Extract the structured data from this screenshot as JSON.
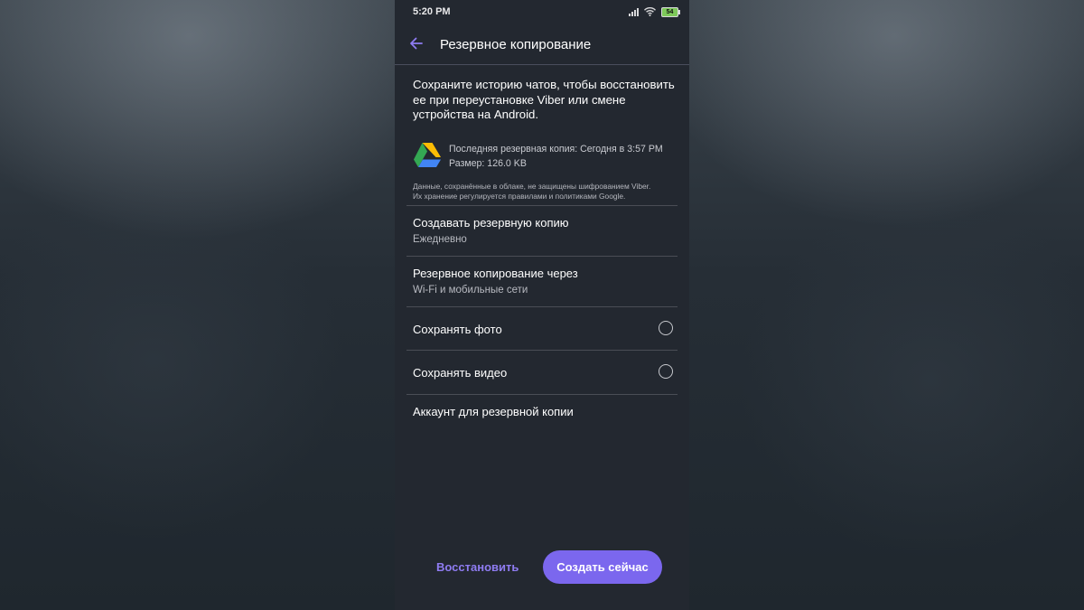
{
  "status_bar": {
    "time": "5:20 PM",
    "battery": "54"
  },
  "app_bar": {
    "title": "Резервное копирование"
  },
  "intro_text": "Сохраните историю чатов, чтобы восстановить ее при переустановке Viber или смене устройства на Android.",
  "backup_info": {
    "last_backup": "Последняя резервная копия: Сегодня в 3:57 PM",
    "size": "Размер: 126.0 KB"
  },
  "notice": {
    "line1": "Данные, сохранённые в облаке, не защищены шифрованием Viber.",
    "line2": "Их хранение регулируется правилами и политиками Google."
  },
  "settings": {
    "create_backup": {
      "title": "Создавать резервную копию",
      "value": "Ежедневно"
    },
    "backup_via": {
      "title": "Резервное копирование через",
      "value": "Wi-Fi и мобильные сети"
    },
    "save_photos": {
      "title": "Сохранять фото",
      "checked": false
    },
    "save_videos": {
      "title": "Сохранять видео",
      "checked": false
    },
    "backup_account": {
      "title": "Аккаунт для резервной копии"
    }
  },
  "actions": {
    "restore": "Восстановить",
    "create_now": "Создать сейчас"
  },
  "colors": {
    "accent": "#7b67ee",
    "accent_text": "#8f7cf2",
    "background": "#232830"
  }
}
